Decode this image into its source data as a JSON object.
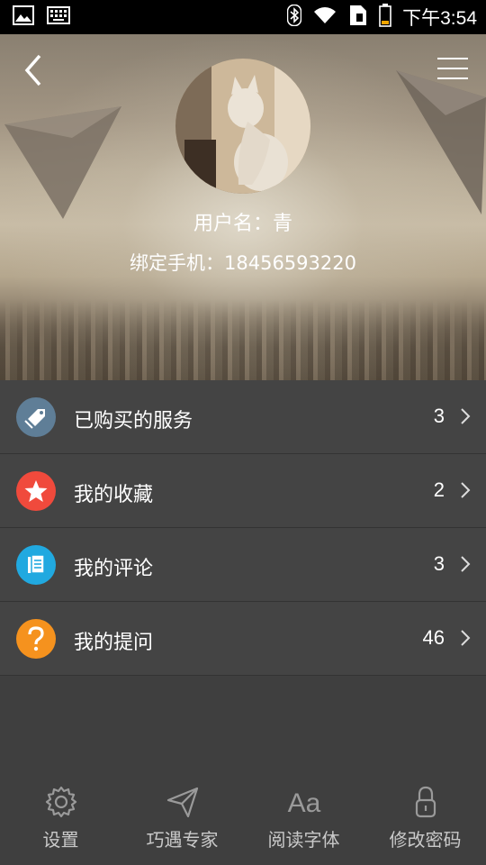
{
  "status_bar": {
    "time": "下午3:54",
    "left_icons": [
      "image-icon",
      "keyboard-icon"
    ],
    "right_icons": [
      "bluetooth-icon",
      "wifi-icon",
      "sim-icon",
      "battery-icon"
    ]
  },
  "header": {
    "back_icon": "chevron-left-icon",
    "menu_icon": "hamburger-menu-icon",
    "username": "用户名：青",
    "phone": "绑定手机：18456593220"
  },
  "menu_items": [
    {
      "label": "已购买的服务",
      "count": "3",
      "icon": "tag-icon",
      "color": "#5f7e97"
    },
    {
      "label": "我的收藏",
      "count": "2",
      "icon": "star-icon",
      "color": "#f04a3c"
    },
    {
      "label": "我的评论",
      "count": "3",
      "icon": "document-icon",
      "color": "#21a9e0"
    },
    {
      "label": "我的提问",
      "count": "46",
      "icon": "question-icon",
      "color": "#f5921e"
    }
  ],
  "bottom_tabs": [
    {
      "label": "设置",
      "icon": "gear-icon"
    },
    {
      "label": "巧遇专家",
      "icon": "paper-plane-icon"
    },
    {
      "label": "阅读字体",
      "icon": "font-size-icon",
      "glyph": "Aa"
    },
    {
      "label": "修改密码",
      "icon": "lock-icon"
    }
  ],
  "colors": {
    "background": "#3f3f3f",
    "row_bg": "#444444",
    "status_bar": "#000000"
  }
}
